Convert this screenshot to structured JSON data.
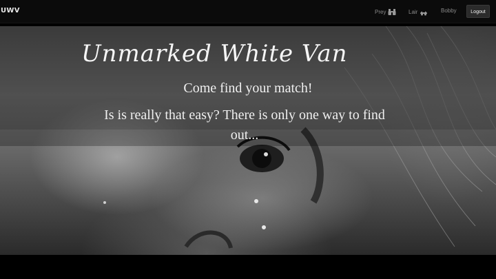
{
  "navbar": {
    "brand": "UWV",
    "items": [
      {
        "label": "Prey",
        "icon": "binoculars-icon"
      },
      {
        "label": "Lair",
        "icon": "lair-icon"
      },
      {
        "label": "Bobby"
      }
    ],
    "logout_label": "Logout"
  },
  "hero": {
    "title": "Unmarked White Van",
    "subtitle": "Come find your match!",
    "tagline": "Is is really that easy? There is only one way to find out..."
  },
  "colors": {
    "navbar_bg": "#0b0b0b",
    "text": "#f0f0f0",
    "nav_text": "#8a8a8a",
    "logout_bg": "#2b2b2b"
  }
}
